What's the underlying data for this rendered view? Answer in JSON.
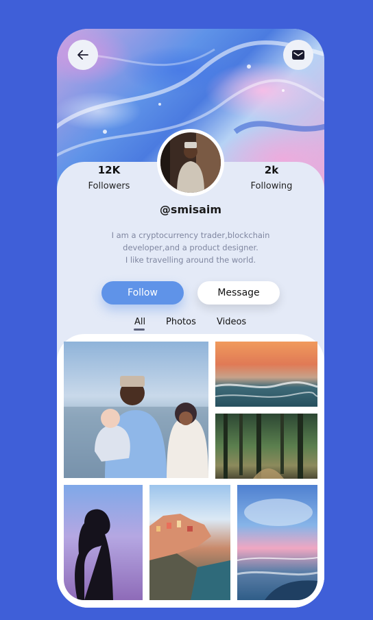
{
  "colors": {
    "background": "#3f5fd8",
    "accent": "#5f93e8",
    "panel": "#e4eaf7"
  },
  "header": {
    "back_icon": "arrow-left-icon",
    "mail_icon": "mail-icon"
  },
  "profile": {
    "followers_count": "12K",
    "followers_label": "Followers",
    "following_count": "2k",
    "following_label": "Following",
    "username": "@smisaim",
    "bio_lines": [
      "I am a cryptocurrency trader,blockchain",
      "developer,and a product designer.",
      "I like travelling around the world."
    ]
  },
  "actions": {
    "follow_label": "Follow",
    "message_label": "Message"
  },
  "tabs": [
    {
      "label": "All",
      "active": true
    },
    {
      "label": "Photos",
      "active": false
    },
    {
      "label": "Videos",
      "active": false
    }
  ]
}
